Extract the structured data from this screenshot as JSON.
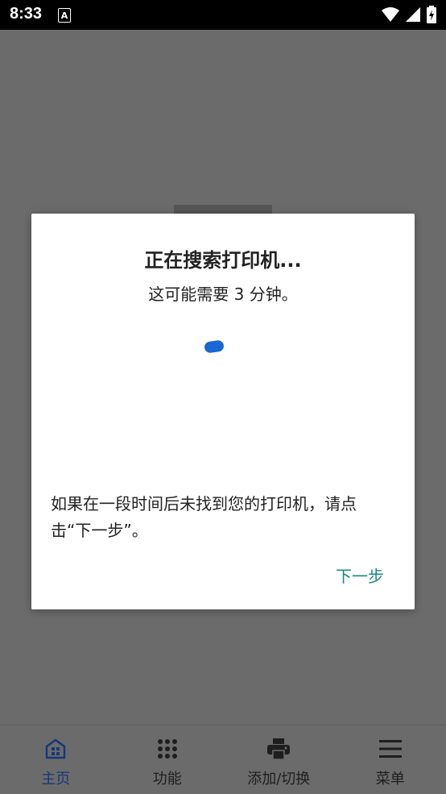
{
  "status_bar": {
    "time": "8:33",
    "notification_letter": "A",
    "icons": [
      "wifi-icon",
      "signal-icon",
      "battery-charging-icon"
    ]
  },
  "dialog": {
    "title": "正在搜索打印机...",
    "subtitle": "这可能需要 3 分钟。",
    "spinner_color": "#1967d2",
    "body": "如果在一段时间后未找到您的打印机，请点击“下一步”。",
    "next_label": "下一步",
    "next_color": "#1a8a80"
  },
  "bottom_nav": {
    "items": [
      {
        "label": "主页",
        "icon": "home-icon",
        "active": true
      },
      {
        "label": "功能",
        "icon": "apps-grid-icon",
        "active": false
      },
      {
        "label": "添加/切换",
        "icon": "printer-icon",
        "active": false
      },
      {
        "label": "菜单",
        "icon": "menu-icon",
        "active": false
      }
    ],
    "active_color": "#17377a"
  }
}
